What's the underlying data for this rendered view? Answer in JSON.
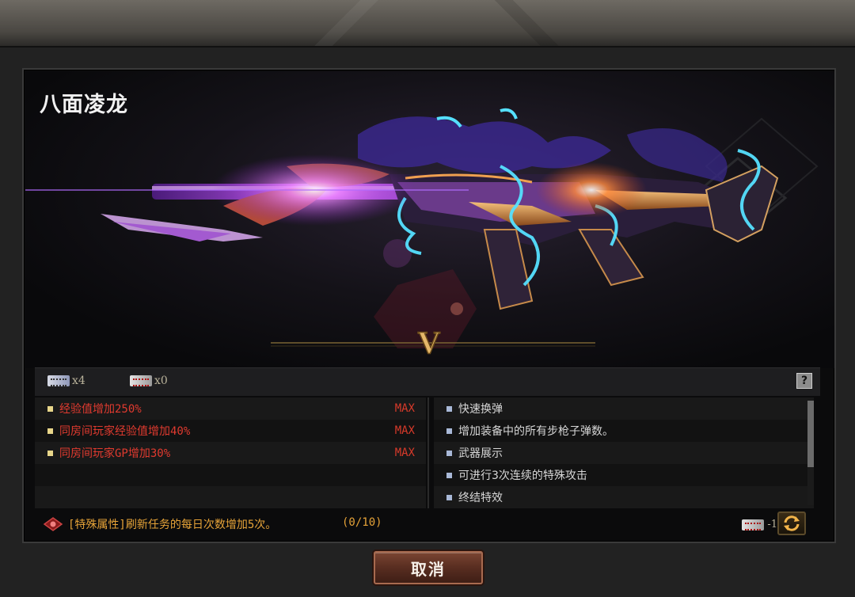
{
  "weapon": {
    "name": "八面凌龙",
    "tier": "V"
  },
  "tickets": [
    {
      "count": "x4"
    },
    {
      "count": "x0"
    }
  ],
  "help_label": "?",
  "attributes_left": [
    {
      "text": "经验值增加250%",
      "tag": "MAX"
    },
    {
      "text": "同房间玩家经验值增加40%",
      "tag": "MAX"
    },
    {
      "text": "同房间玩家GP增加30%",
      "tag": "MAX"
    }
  ],
  "attributes_right": [
    {
      "text": "快速换弹"
    },
    {
      "text": "增加装备中的所有步枪子弹数。"
    },
    {
      "text": "武器展示"
    },
    {
      "text": "可进行3次连续的特殊攻击"
    },
    {
      "text": "终结特效"
    }
  ],
  "special": {
    "text": "[特殊属性]刷新任务的每日次数增加5次。",
    "progress": "(0/10)",
    "cost": "-1"
  },
  "cancel_label": "取消",
  "colors": {
    "accent_red": "#e03a2f",
    "accent_orange": "#e6a338"
  }
}
